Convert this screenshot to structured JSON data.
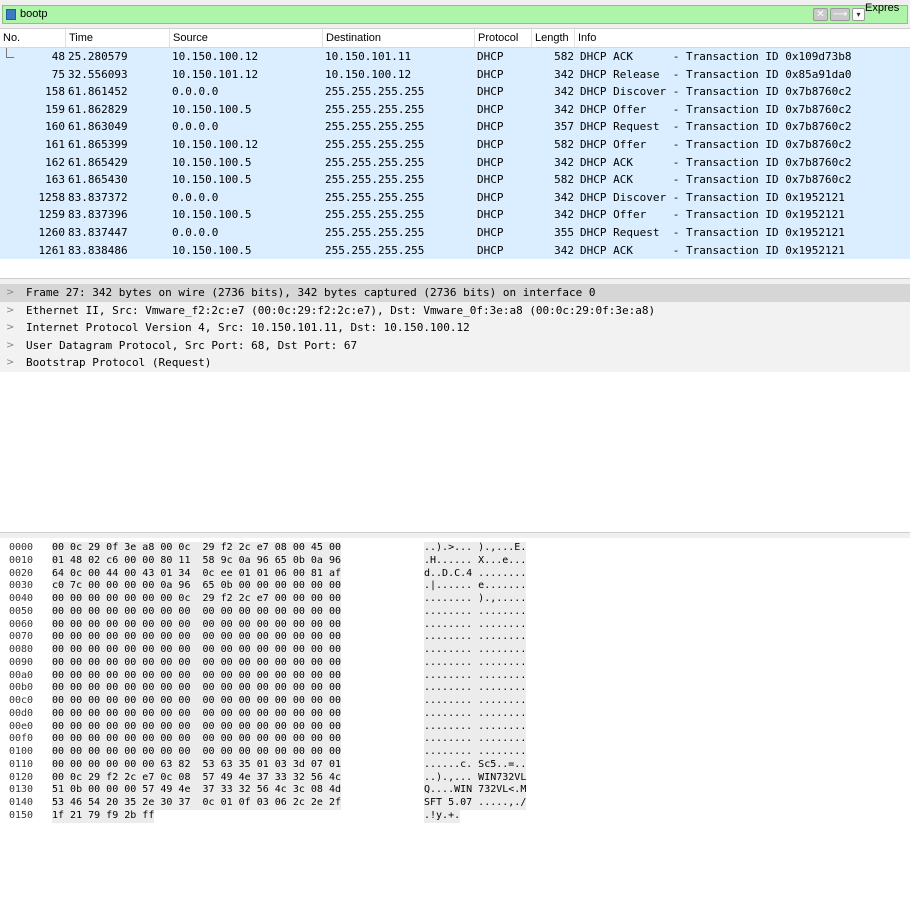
{
  "filter": {
    "value": "bootp",
    "expression_label": "Expres",
    "clear_glyph": "✕",
    "apply_glyph": "⟶",
    "dropdown_glyph": "▾"
  },
  "columns": [
    "No.",
    "Time",
    "Source",
    "Destination",
    "Protocol",
    "Length",
    "Info"
  ],
  "packets": [
    {
      "no": "48",
      "time": "25.280579",
      "src": "10.150.100.12",
      "dst": "10.150.101.11",
      "proto": "DHCP",
      "len": "582",
      "info": "DHCP ACK      - Transaction ID 0x109d73b8"
    },
    {
      "no": "75",
      "time": "32.556093",
      "src": "10.150.101.12",
      "dst": "10.150.100.12",
      "proto": "DHCP",
      "len": "342",
      "info": "DHCP Release  - Transaction ID 0x85a91da0"
    },
    {
      "no": "158",
      "time": "61.861452",
      "src": "0.0.0.0",
      "dst": "255.255.255.255",
      "proto": "DHCP",
      "len": "342",
      "info": "DHCP Discover - Transaction ID 0x7b8760c2"
    },
    {
      "no": "159",
      "time": "61.862829",
      "src": "10.150.100.5",
      "dst": "255.255.255.255",
      "proto": "DHCP",
      "len": "342",
      "info": "DHCP Offer    - Transaction ID 0x7b8760c2"
    },
    {
      "no": "160",
      "time": "61.863049",
      "src": "0.0.0.0",
      "dst": "255.255.255.255",
      "proto": "DHCP",
      "len": "357",
      "info": "DHCP Request  - Transaction ID 0x7b8760c2"
    },
    {
      "no": "161",
      "time": "61.865399",
      "src": "10.150.100.12",
      "dst": "255.255.255.255",
      "proto": "DHCP",
      "len": "582",
      "info": "DHCP Offer    - Transaction ID 0x7b8760c2"
    },
    {
      "no": "162",
      "time": "61.865429",
      "src": "10.150.100.5",
      "dst": "255.255.255.255",
      "proto": "DHCP",
      "len": "342",
      "info": "DHCP ACK      - Transaction ID 0x7b8760c2"
    },
    {
      "no": "163",
      "time": "61.865430",
      "src": "10.150.100.5",
      "dst": "255.255.255.255",
      "proto": "DHCP",
      "len": "582",
      "info": "DHCP ACK      - Transaction ID 0x7b8760c2"
    },
    {
      "no": "1258",
      "time": "83.837372",
      "src": "0.0.0.0",
      "dst": "255.255.255.255",
      "proto": "DHCP",
      "len": "342",
      "info": "DHCP Discover - Transaction ID 0x1952121"
    },
    {
      "no": "1259",
      "time": "83.837396",
      "src": "10.150.100.5",
      "dst": "255.255.255.255",
      "proto": "DHCP",
      "len": "342",
      "info": "DHCP Offer    - Transaction ID 0x1952121"
    },
    {
      "no": "1260",
      "time": "83.837447",
      "src": "0.0.0.0",
      "dst": "255.255.255.255",
      "proto": "DHCP",
      "len": "355",
      "info": "DHCP Request  - Transaction ID 0x1952121"
    },
    {
      "no": "1261",
      "time": "83.838486",
      "src": "10.150.100.5",
      "dst": "255.255.255.255",
      "proto": "DHCP",
      "len": "342",
      "info": "DHCP ACK      - Transaction ID 0x1952121"
    }
  ],
  "details": [
    {
      "text": "Frame 27: 342 bytes on wire (2736 bits), 342 bytes captured (2736 bits) on interface 0",
      "selected": true
    },
    {
      "text": "Ethernet II, Src: Vmware_f2:2c:e7 (00:0c:29:f2:2c:e7), Dst: Vmware_0f:3e:a8 (00:0c:29:0f:3e:a8)",
      "selected": false
    },
    {
      "text": "Internet Protocol Version 4, Src: 10.150.101.11, Dst: 10.150.100.12",
      "selected": false
    },
    {
      "text": "User Datagram Protocol, Src Port: 68, Dst Port: 67",
      "selected": false
    },
    {
      "text": "Bootstrap Protocol (Request)",
      "selected": false
    }
  ],
  "expand_glyph": ">",
  "bytes": [
    {
      "off": "0000",
      "hex": "00 0c 29 0f 3e a8 00 0c  29 f2 2c e7 08 00 45 00",
      "ascii": "..).>... ).,...E."
    },
    {
      "off": "0010",
      "hex": "01 48 02 c6 00 00 80 11  58 9c 0a 96 65 0b 0a 96",
      "ascii": ".H...... X...e..."
    },
    {
      "off": "0020",
      "hex": "64 0c 00 44 00 43 01 34  0c ee 01 01 06 00 81 af",
      "ascii": "d..D.C.4 ........"
    },
    {
      "off": "0030",
      "hex": "c0 7c 00 00 00 00 0a 96  65 0b 00 00 00 00 00 00",
      "ascii": ".|...... e......."
    },
    {
      "off": "0040",
      "hex": "00 00 00 00 00 00 00 0c  29 f2 2c e7 00 00 00 00",
      "ascii": "........ ).,....."
    },
    {
      "off": "0050",
      "hex": "00 00 00 00 00 00 00 00  00 00 00 00 00 00 00 00",
      "ascii": "........ ........"
    },
    {
      "off": "0060",
      "hex": "00 00 00 00 00 00 00 00  00 00 00 00 00 00 00 00",
      "ascii": "........ ........"
    },
    {
      "off": "0070",
      "hex": "00 00 00 00 00 00 00 00  00 00 00 00 00 00 00 00",
      "ascii": "........ ........"
    },
    {
      "off": "0080",
      "hex": "00 00 00 00 00 00 00 00  00 00 00 00 00 00 00 00",
      "ascii": "........ ........"
    },
    {
      "off": "0090",
      "hex": "00 00 00 00 00 00 00 00  00 00 00 00 00 00 00 00",
      "ascii": "........ ........"
    },
    {
      "off": "00a0",
      "hex": "00 00 00 00 00 00 00 00  00 00 00 00 00 00 00 00",
      "ascii": "........ ........"
    },
    {
      "off": "00b0",
      "hex": "00 00 00 00 00 00 00 00  00 00 00 00 00 00 00 00",
      "ascii": "........ ........"
    },
    {
      "off": "00c0",
      "hex": "00 00 00 00 00 00 00 00  00 00 00 00 00 00 00 00",
      "ascii": "........ ........"
    },
    {
      "off": "00d0",
      "hex": "00 00 00 00 00 00 00 00  00 00 00 00 00 00 00 00",
      "ascii": "........ ........"
    },
    {
      "off": "00e0",
      "hex": "00 00 00 00 00 00 00 00  00 00 00 00 00 00 00 00",
      "ascii": "........ ........"
    },
    {
      "off": "00f0",
      "hex": "00 00 00 00 00 00 00 00  00 00 00 00 00 00 00 00",
      "ascii": "........ ........"
    },
    {
      "off": "0100",
      "hex": "00 00 00 00 00 00 00 00  00 00 00 00 00 00 00 00",
      "ascii": "........ ........"
    },
    {
      "off": "0110",
      "hex": "00 00 00 00 00 00 63 82  53 63 35 01 03 3d 07 01",
      "ascii": "......c. Sc5..=.."
    },
    {
      "off": "0120",
      "hex": "00 0c 29 f2 2c e7 0c 08  57 49 4e 37 33 32 56 4c",
      "ascii": "..).,... WIN732VL"
    },
    {
      "off": "0130",
      "hex": "51 0b 00 00 00 57 49 4e  37 33 32 56 4c 3c 08 4d",
      "ascii": "Q....WIN 732VL<.M"
    },
    {
      "off": "0140",
      "hex": "53 46 54 20 35 2e 30 37  0c 01 0f 03 06 2c 2e 2f",
      "ascii": "SFT 5.07 .....,./"
    },
    {
      "off": "0150",
      "hex": "1f 21 79 f9 2b ff",
      "ascii": ".!y.+."
    }
  ],
  "colors": {
    "filter_bg": "#aff5a9",
    "row_bg": "#daeeff",
    "detail_bg": "#f2f2f2",
    "detail_selected_bg": "#d6d6d6",
    "hex_bg": "#ececec"
  },
  "icons": {
    "bookmark": "bookmark-icon",
    "clear": "clear-filter-icon",
    "apply": "apply-arrow-icon",
    "dropdown": "chevron-down-icon",
    "expand": "chevron-right-icon"
  }
}
